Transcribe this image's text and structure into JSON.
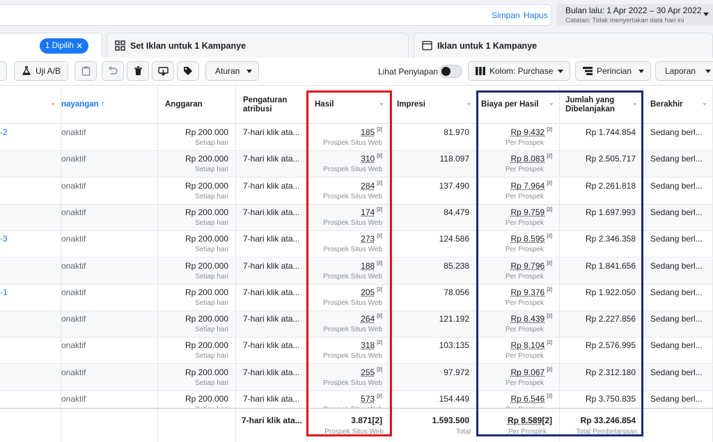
{
  "header": {
    "save_label": "Simpan",
    "delete_label": "Hapus",
    "date_range": "Bulan lalu: 1 Apr 2022 – 30 Apr 2022",
    "date_note": "Catatan: Tidak menyertakan data hari ini"
  },
  "tabs": {
    "selected_pill": "1 Dipilih",
    "adsets_tab": "Set Iklan untuk 1 Kampanye",
    "ads_tab": "Iklan untuk 1 Kampanye"
  },
  "toolbar": {
    "ab_test": "Uji A/B",
    "rules": "Aturan",
    "preview_label": "Lihat Penyiapan",
    "columns": "Kolom: Purchase",
    "breakdown": "Perincian",
    "reports": "Laporan"
  },
  "columns": {
    "delivery": "nayangan ↑",
    "budget": "Anggaran",
    "attribution": "Pengaturan atribusi",
    "results": "Hasil",
    "impressions": "Impresi",
    "cost_per_result": "Biaya per Hasil",
    "amount_spent": "Jumlah yang Dibelanjakan",
    "ends": "Berakhir"
  },
  "rows": [
    {
      "name": "-2",
      "delivery": "onaktif",
      "budget": "Rp 200.000",
      "budget_sub": "Setiap hari",
      "attribution": "7-hari klik ata...",
      "results": "185",
      "results_sub": "Prospek Situs Web",
      "impressions": "81.970",
      "cpr": "Rp 9.432",
      "cpr_sub": "Per Prospek",
      "spent": "Rp 1.744.854",
      "ends": "Sedang berl..."
    },
    {
      "name": "",
      "delivery": "onaktif",
      "budget": "Rp 200.000",
      "budget_sub": "Setiap hari",
      "attribution": "7-hari klik ata...",
      "results": "310",
      "results_sub": "Prospek Situs Web",
      "impressions": "118.097",
      "cpr": "Rp 8.083",
      "cpr_sub": "Per Prospek",
      "spent": "Rp 2.505.717",
      "ends": "Sedang berl..."
    },
    {
      "name": "",
      "delivery": "onaktif",
      "budget": "Rp 200.000",
      "budget_sub": "Setiap hari",
      "attribution": "7-hari klik ata...",
      "results": "284",
      "results_sub": "Prospek Situs Web",
      "impressions": "137.490",
      "cpr": "Rp 7.964",
      "cpr_sub": "Per Prospek",
      "spent": "Rp 2.261.818",
      "ends": "Sedang berl..."
    },
    {
      "name": "",
      "delivery": "onaktif",
      "budget": "Rp 200.000",
      "budget_sub": "Setiap hari",
      "attribution": "7-hari klik ata...",
      "results": "174",
      "results_sub": "Prospek Situs Web",
      "impressions": "84.479",
      "cpr": "Rp 9.759",
      "cpr_sub": "Per Prospek",
      "spent": "Rp 1.697.993",
      "ends": "Sedang berl..."
    },
    {
      "name": "-3",
      "delivery": "onaktif",
      "budget": "Rp 200.000",
      "budget_sub": "Setiap hari",
      "attribution": "7-hari klik ata...",
      "results": "273",
      "results_sub": "Prospek Situs Web",
      "impressions": "124.586",
      "cpr": "Rp 8.595",
      "cpr_sub": "Per Prospek",
      "spent": "Rp 2.346.358",
      "ends": "Sedang berl..."
    },
    {
      "name": "",
      "delivery": "onaktif",
      "budget": "Rp 200.000",
      "budget_sub": "Setiap hari",
      "attribution": "7-hari klik ata...",
      "results": "188",
      "results_sub": "Prospek Situs Web",
      "impressions": "85.238",
      "cpr": "Rp 9.796",
      "cpr_sub": "Per Prospek",
      "spent": "Rp 1.841.656",
      "ends": "Sedang berl..."
    },
    {
      "name": "-1",
      "delivery": "onaktif",
      "budget": "Rp 200.000",
      "budget_sub": "Setiap hari",
      "attribution": "7-hari klik ata...",
      "results": "205",
      "results_sub": "Prospek Situs Web",
      "impressions": "78.056",
      "cpr": "Rp 9.376",
      "cpr_sub": "Per Prospek",
      "spent": "Rp 1.922.050",
      "ends": "Sedang berl..."
    },
    {
      "name": "",
      "delivery": "onaktif",
      "budget": "Rp 200.000",
      "budget_sub": "Setiap hari",
      "attribution": "7-hari klik ata...",
      "results": "264",
      "results_sub": "Prospek Situs Web",
      "impressions": "121.192",
      "cpr": "Rp 8.439",
      "cpr_sub": "Per Prospek",
      "spent": "Rp 2.227.856",
      "ends": "Sedang berl..."
    },
    {
      "name": "",
      "delivery": "onaktif",
      "budget": "Rp 200.000",
      "budget_sub": "Setiap hari",
      "attribution": "7-hari klik ata...",
      "results": "318",
      "results_sub": "Prospek Situs Web",
      "impressions": "103.135",
      "cpr": "Rp 8.104",
      "cpr_sub": "Per Prospek",
      "spent": "Rp 2.576.995",
      "ends": "Sedang berl..."
    },
    {
      "name": "",
      "delivery": "onaktif",
      "budget": "Rp 200.000",
      "budget_sub": "Setiap hari",
      "attribution": "7-hari klik ata...",
      "results": "255",
      "results_sub": "Prospek Situs Web",
      "impressions": "97.972",
      "cpr": "Rp 9.067",
      "cpr_sub": "Per Prospek",
      "spent": "Rp 2.312.180",
      "ends": "Sedang berl..."
    },
    {
      "name": "",
      "delivery": "onaktif",
      "budget": "Rp 200.000",
      "budget_sub": "Setiap hari",
      "attribution": "7-hari klik ata...",
      "results": "573",
      "results_sub": "Prospek Situs Web",
      "impressions": "154.449",
      "cpr": "Rp 6.546",
      "cpr_sub": "Per Prospek",
      "spent": "Rp 3.750.835",
      "ends": "Sedang berl..."
    }
  ],
  "totals": {
    "attribution": "7-hari klik ata...",
    "results": "3.871",
    "results_sub": "Prospek Situs Web",
    "impressions": "1.593.500",
    "impressions_sub": "Total",
    "cpr": "Rp 8.589",
    "cpr_sub": "Per Prospek",
    "spent": "Rp 33.246.854",
    "spent_sub": "Total Pembelanjaan"
  },
  "colors": {
    "accent": "#1877f2",
    "highlight_results": "#e0141b",
    "highlight_cost": "#1b2a7a"
  }
}
